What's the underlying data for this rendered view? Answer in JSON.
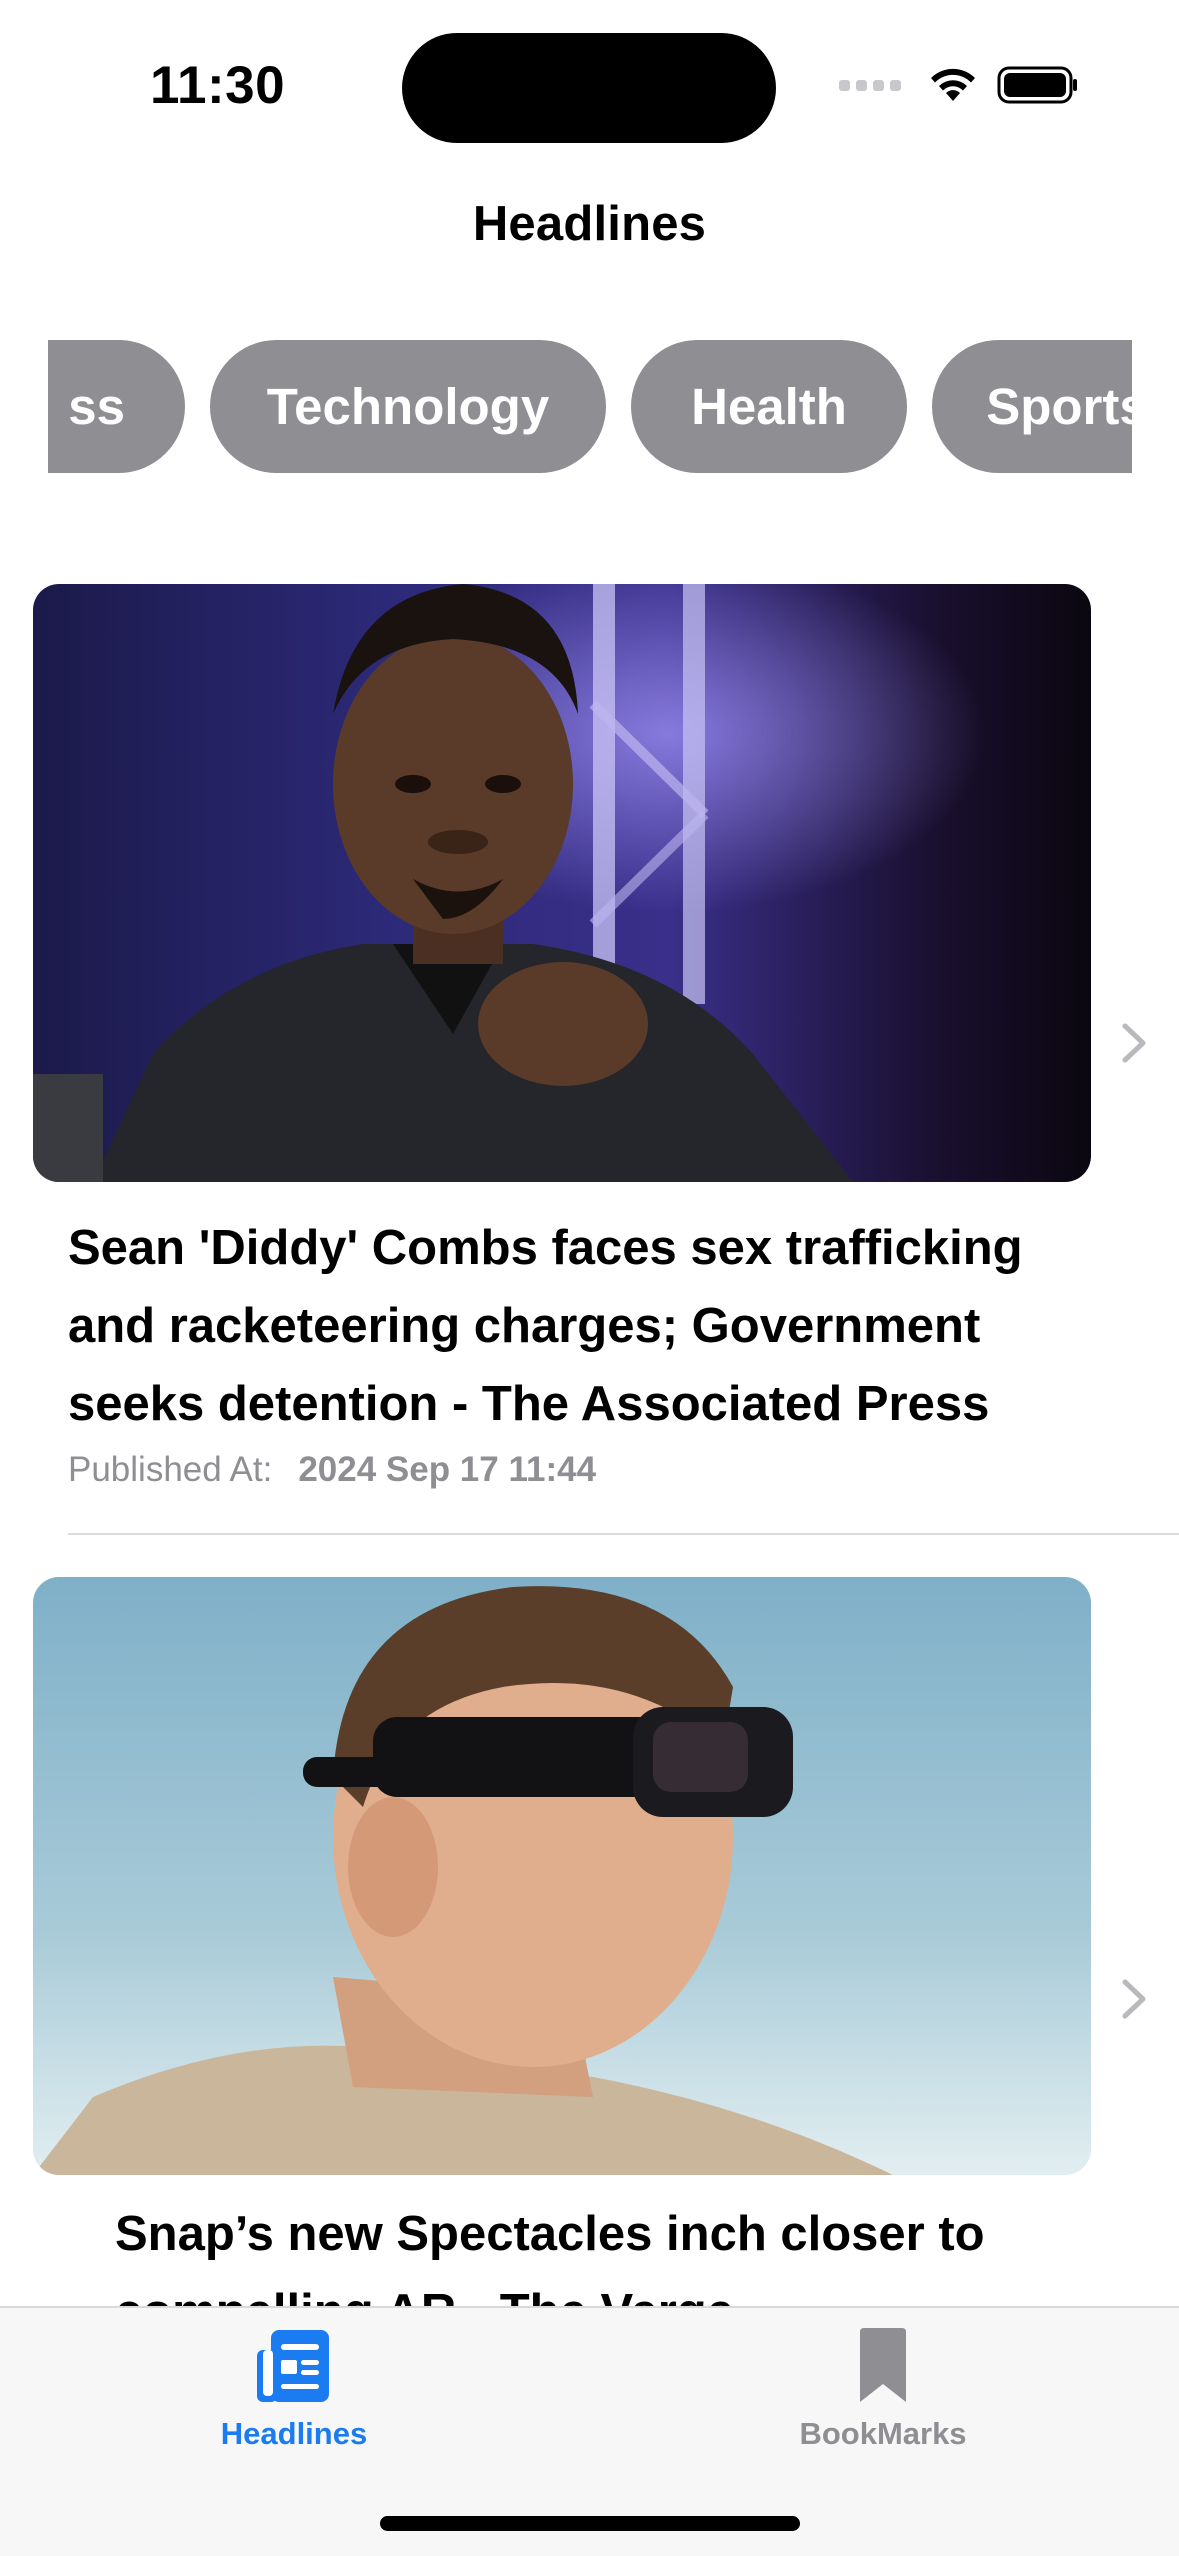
{
  "status_bar": {
    "time": "11:30"
  },
  "nav": {
    "title": "Headlines"
  },
  "categories": {
    "items": [
      "ss",
      "Technology",
      "Health",
      "Sports"
    ],
    "pill_color": "#8e8e93"
  },
  "articles": [
    {
      "title": "Sean 'Diddy' Combs faces sex trafficking and racketeering charges; Government seeks detention - The Associated Press",
      "published_label": "Published At:",
      "published_date": "2024 Sep 17 11:44"
    },
    {
      "title": "Snap’s new Spectacles inch closer to compelling AR - The Verge"
    }
  ],
  "tab_bar": {
    "headlines_label": "Headlines",
    "bookmarks_label": "BookMarks",
    "active_color": "#1a7cf0",
    "inactive_color": "#8e8e93",
    "headlines_icon": "newspaper-icon",
    "bookmarks_icon": "bookmark-icon"
  }
}
